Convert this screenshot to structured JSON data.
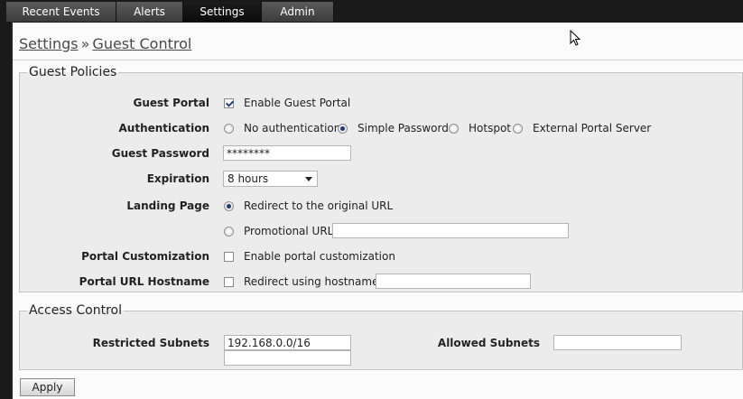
{
  "tabs": [
    {
      "label": "Recent Events"
    },
    {
      "label": "Alerts"
    },
    {
      "label": "Settings"
    },
    {
      "label": "Admin"
    }
  ],
  "breadcrumb": {
    "parent": "Settings",
    "separator": "»",
    "current": "Guest Control"
  },
  "guest_policies": {
    "legend": "Guest Policies",
    "guest_portal": {
      "label": "Guest Portal",
      "option": "Enable Guest Portal",
      "checked": true
    },
    "authentication": {
      "label": "Authentication",
      "options": [
        {
          "label": "No authentication",
          "selected": false
        },
        {
          "label": "Simple Password",
          "selected": true
        },
        {
          "label": "Hotspot",
          "selected": false
        },
        {
          "label": "External Portal Server",
          "selected": false
        }
      ]
    },
    "guest_password": {
      "label": "Guest Password",
      "value": "********"
    },
    "expiration": {
      "label": "Expiration",
      "value": "8 hours"
    },
    "landing_page": {
      "label": "Landing Page",
      "redirect_option": "Redirect to the original URL",
      "redirect_selected": true,
      "promo_option": "Promotional URL",
      "promo_value": ""
    },
    "portal_customization": {
      "label": "Portal Customization",
      "option": "Enable portal customization",
      "checked": false
    },
    "portal_url_hostname": {
      "label": "Portal URL Hostname",
      "option": "Redirect using hostname",
      "value": "",
      "checked": false
    }
  },
  "access_control": {
    "legend": "Access Control",
    "restricted_subnets": {
      "label": "Restricted Subnets",
      "values": [
        "192.168.0.0/16",
        ""
      ]
    },
    "allowed_subnets": {
      "label": "Allowed Subnets",
      "value": ""
    }
  },
  "apply_label": "Apply"
}
